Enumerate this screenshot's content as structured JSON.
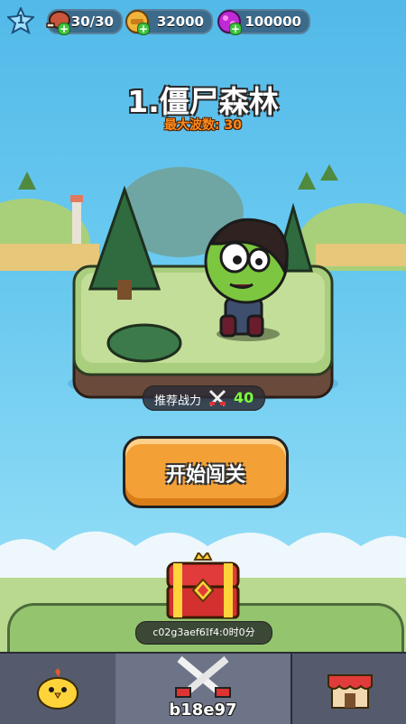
{
  "hud": {
    "level": "1",
    "meat": "30/30",
    "coins": "32000",
    "gems": "100000",
    "icons": [
      "meat-icon",
      "coin-icon",
      "gem-icon"
    ]
  },
  "stage": {
    "title": "1.僵尸森林",
    "max_wave": "最大波数: 30"
  },
  "power": {
    "label": "推荐战力",
    "value": "40"
  },
  "start_button": "开始闯关",
  "chest": {
    "timer": "c02g3aef6𝕀f4:0时0分"
  },
  "nav": {
    "mid_code": "b18e97",
    "items": [
      "chick-icon",
      "crossed-swords-icon",
      "shop-icon"
    ]
  },
  "colors": {
    "accent": "#f3a037",
    "power_value": "#7dff3a",
    "max_wave": "#ff8a1a"
  }
}
